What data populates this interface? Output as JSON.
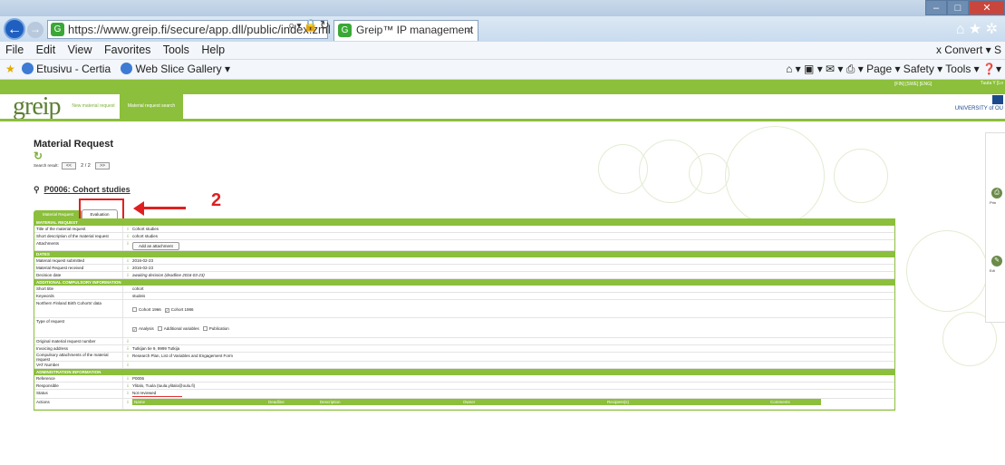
{
  "browser": {
    "url": "https://www.greip.fi/secure/app.dll/public/index.zml",
    "tab_title": "Greip™ IP management sof...",
    "menu": [
      "File",
      "Edit",
      "View",
      "Favorites",
      "Tools",
      "Help"
    ],
    "menu_right": "x  Convert ▾  S",
    "favorites": [
      "Etusivu - Certia",
      "Web Slice Gallery ▾"
    ],
    "command_bar": "Page ▾  Safety ▾  Tools ▾"
  },
  "app": {
    "lang_links": "[FIN] [SWE] [ENG]",
    "user": "Tuula Y\n[Lo",
    "logo": "greip",
    "nav": [
      "New material request",
      "Material request search"
    ],
    "university": "UNIVERSITY of OU"
  },
  "page": {
    "title": "Material Request",
    "search_label": "Search result:",
    "prev": "<<",
    "position": "2 / 2",
    "next": ">>",
    "project": "P0006: Cohort studies",
    "tabs": [
      "Material Request",
      "Evaluation"
    ]
  },
  "annotation": {
    "number": "2",
    "color": "#e02020"
  },
  "form": {
    "sections": {
      "material": "MATERIAL REQUEST",
      "dates": "DATES",
      "additional": "ADDITIONAL COMPULSORY INFORMATION",
      "admin": "ADMINISTRATION INFORMATION"
    },
    "rows": {
      "title_lbl": "Title of the material request",
      "title_val": "Cohort studies",
      "short_lbl": "Short description of the material request",
      "short_val": "cohort studies",
      "attach_lbl": "Attachments",
      "attach_btn": "Add an attachment",
      "submitted_lbl": "Material request submitted",
      "submitted_val": "2016-02-23",
      "received_lbl": "Material Request received",
      "received_val": "2016-02-23",
      "decision_lbl": "Decision date",
      "decision_val": "awaiting decision (deadline 2016-03-23)",
      "shorttitle_lbl": "Short title",
      "shorttitle_val": "cohort",
      "keywords_lbl": "Keywords",
      "keywords_val": "studeis",
      "nfbc_lbl": "Northern Finland Birth Cohorts' data",
      "cohort1966": "Cohort 1966",
      "cohort1986": "Cohort 1986",
      "type_lbl": "Type of request",
      "type_analysis": "Analysis",
      "type_additional": "Additional variables",
      "type_publication": "Publication",
      "orig_lbl": "Original material request number",
      "invoice_lbl": "Invoicing address",
      "invoice_val": "Tutkijan tie 9, 9999 Tutkija",
      "compulsory_lbl": "Compulsory attachments of the material request",
      "compulsory_val": "Research Plan, List of Variables and Engagement Form",
      "vat_lbl": "VAT Number",
      "ref_lbl": "Reference",
      "ref_val": "P0006",
      "resp_lbl": "Responsible",
      "resp_val": "Ylitalo, Tuula (tuula.ylitalo@oulu.fi)",
      "status_lbl": "Status",
      "status_val": "Not reviewed",
      "actions_lbl": "Actions"
    },
    "action_cols": [
      "Name",
      "Deadline",
      "Description",
      "Owner",
      "Recipient(s)",
      "Comments"
    ]
  },
  "side": {
    "print": "Prin",
    "edit": "Edi"
  }
}
